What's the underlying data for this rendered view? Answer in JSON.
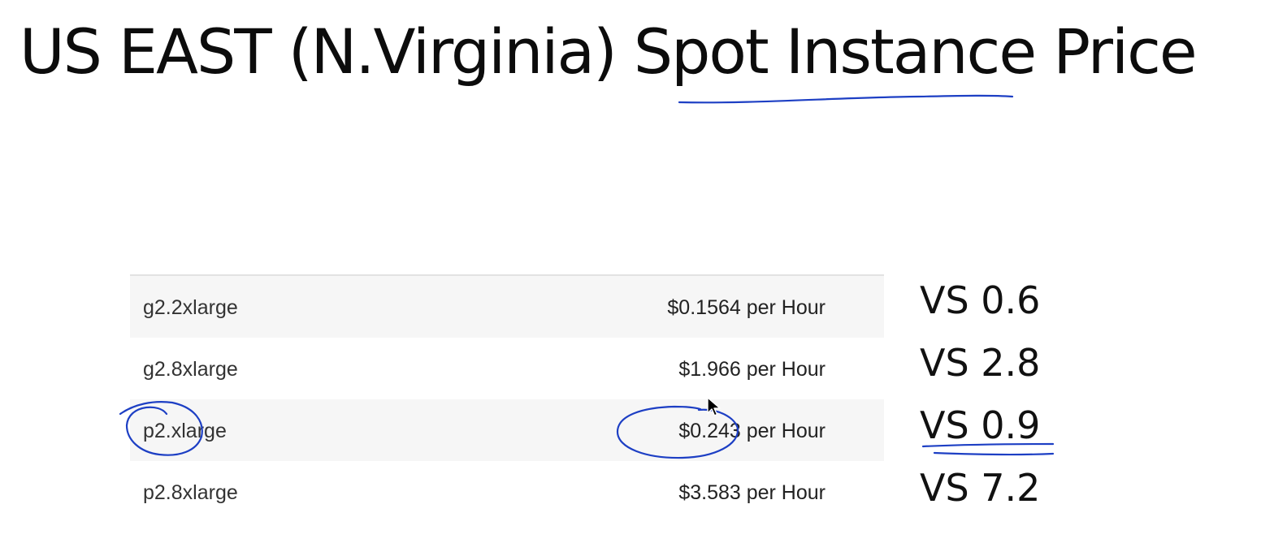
{
  "slide": {
    "title": "US EAST (N.Virginia) Spot Instance Price"
  },
  "table": {
    "rows": [
      {
        "instance": "g2.2xlarge",
        "price": "$0.1564 per Hour"
      },
      {
        "instance": "g2.8xlarge",
        "price": "$1.966 per Hour"
      },
      {
        "instance": "p2.xlarge",
        "price": "$0.243 per Hour"
      },
      {
        "instance": "p2.8xlarge",
        "price": "$3.583 per Hour"
      }
    ]
  },
  "comparisons": [
    "VS 0.6",
    "VS 2.8",
    "VS 0.9",
    "VS 7.2"
  ],
  "colors": {
    "annotation_ink": "#1d3fc4",
    "row_shade": "#f6f6f6"
  },
  "icons": {
    "cursor": "mouse-pointer-icon"
  }
}
